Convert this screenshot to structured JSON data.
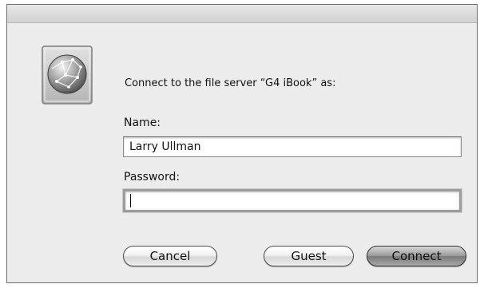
{
  "dialog": {
    "prompt": "Connect to the file server “G4 iBook” as:"
  },
  "name_field": {
    "label": "Name:",
    "value": "Larry Ullman"
  },
  "password_field": {
    "label": "Password:",
    "value": ""
  },
  "buttons": {
    "cancel": "Cancel",
    "guest": "Guest",
    "connect": "Connect"
  },
  "icon": {
    "server": "network-server-globe-icon"
  }
}
